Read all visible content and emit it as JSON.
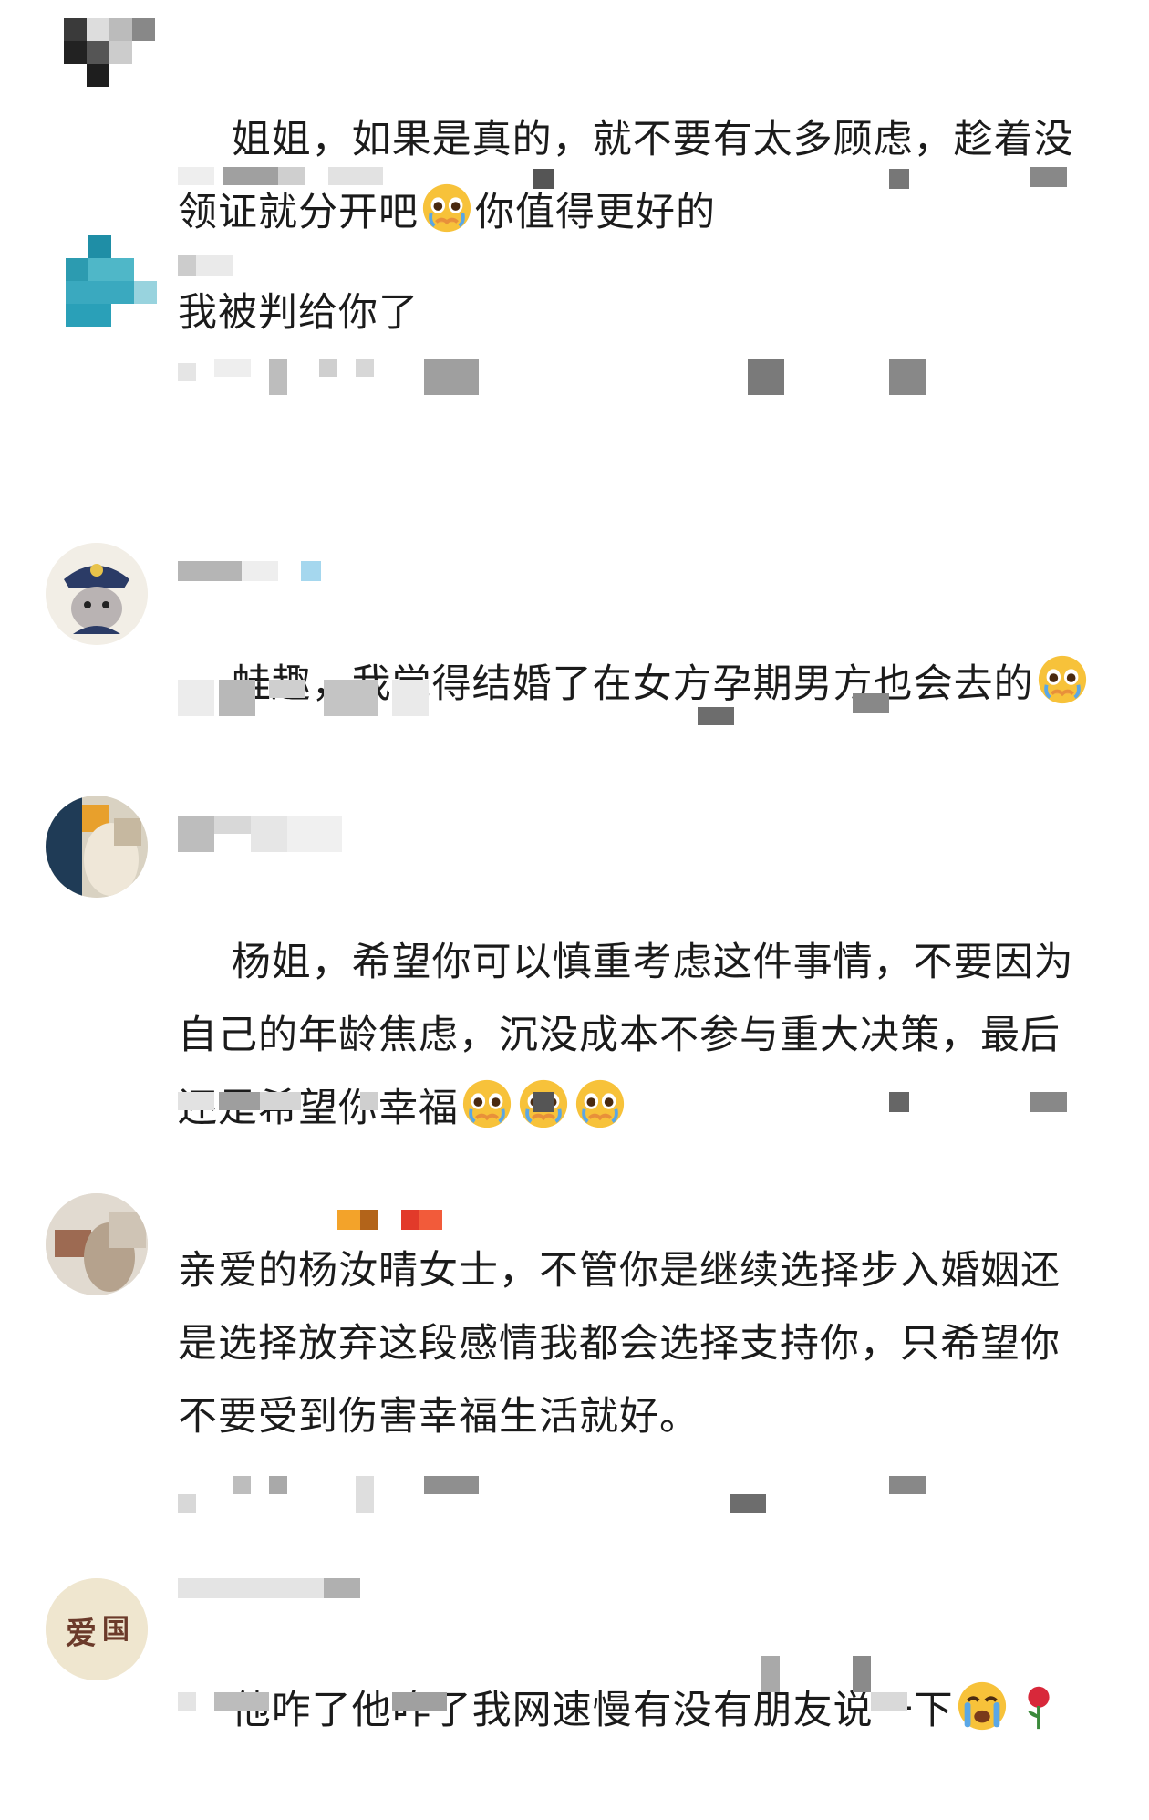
{
  "comments": [
    {
      "text": "姐姐，如果是真的，就不要有太多顾虑，趁着没领证就分开吧",
      "text_after": "你值得更好的",
      "emoji": "pleading-face-icon"
    },
    {
      "text": "我被判给你了"
    },
    {
      "text": "蛙趣，我觉得结婚了在女方孕期男方也会去的",
      "emoji": "pleading-face-icon"
    },
    {
      "text": "杨姐，希望你可以慎重考虑这件事情，不要因为自己的年龄焦虑，沉没成本不参与重大决策，最后还是希望你幸福",
      "emoji": "pleading-face-icon",
      "emoji_count": 3
    },
    {
      "text": "亲爱的杨汝晴女士，不管你是继续选择步入婚姻还是选择放弃这段感情我都会选择支持你，只希望你不要受到伤害幸福生活就好。"
    },
    {
      "text": "他咋了他咋了我网速慢有没有朋友说一下",
      "emoji": "loudly-crying-face-icon",
      "emoji2": "rose-icon"
    }
  ],
  "colors": {
    "text": "#1b1b1b",
    "mosaic_gray": "#9a9a9a",
    "mosaic_light": "#e6e6e6",
    "emoji_yellow": "#f7c23a",
    "emoji_blue": "#5aa7e6",
    "rose_red": "#d8283a"
  }
}
